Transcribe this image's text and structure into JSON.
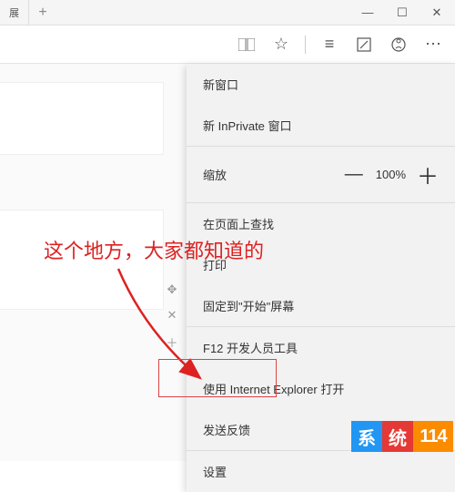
{
  "titlebar": {
    "tab_label": "展",
    "new_tab": "+",
    "minimize": "—",
    "maximize": "☐",
    "close": "✕"
  },
  "toolbar": {
    "reading": "📖",
    "favorite": "☆",
    "hub": "≡",
    "note": "✎",
    "share": "◯",
    "more": "⋯"
  },
  "menu": {
    "new_window": "新窗口",
    "new_inprivate": "新 InPrivate 窗口",
    "zoom_label": "缩放",
    "zoom_minus": "—",
    "zoom_value": "100%",
    "zoom_plus": "＋",
    "find": "在页面上查找",
    "print": "打印",
    "pin": "固定到\"开始\"屏幕",
    "devtools": "F12 开发人员工具",
    "open_ie": "使用 Internet Explorer 打开",
    "feedback": "发送反馈",
    "settings": "设置"
  },
  "side": {
    "move": "✥",
    "close": "✕",
    "add": "＋"
  },
  "annotation": {
    "text": "这个地方，大家都知道的"
  },
  "watermark": {
    "xi": "系",
    "tong": "统",
    "num": "114"
  }
}
